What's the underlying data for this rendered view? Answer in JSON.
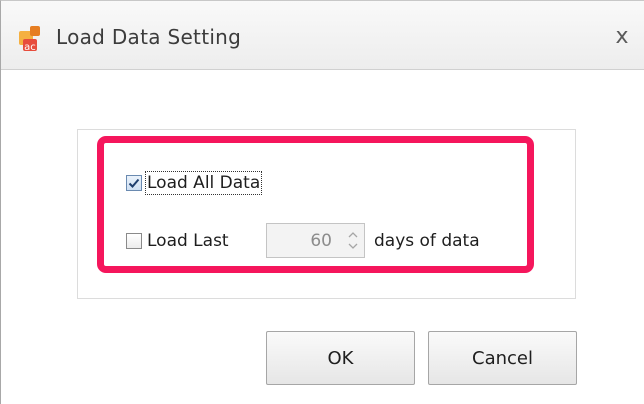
{
  "window": {
    "title": "Load Data Setting",
    "close_glyph": "x",
    "icon": "app-icon"
  },
  "options": {
    "load_all": {
      "label": "Load All Data",
      "checked": true
    },
    "load_last": {
      "label": "Load Last",
      "checked": false,
      "suffix": "days of data"
    },
    "days": {
      "value": "60",
      "enabled": false
    }
  },
  "buttons": {
    "ok_label": "OK",
    "cancel_label": "Cancel"
  },
  "colors": {
    "highlight": "#f5165c"
  }
}
